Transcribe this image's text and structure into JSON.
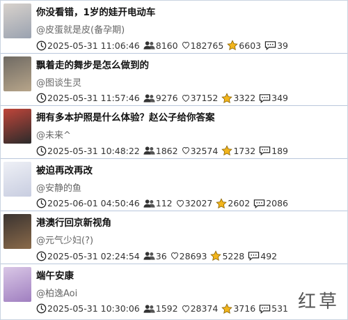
{
  "items": [
    {
      "title": "你没看错，1岁的娃开电动车",
      "author": "@皮蛋就是皮(备孕期)",
      "time": "2025-05-31 11:06:46",
      "viewers": "8160",
      "likes": "182765",
      "stars": "6603",
      "comments": "39",
      "thumb_colors": [
        "#d8d2cc",
        "#9aa2b0"
      ]
    },
    {
      "title": "飘着走的舞步是怎么做到的",
      "author": "@图谈生灵",
      "time": "2025-05-31 11:57:46",
      "viewers": "9276",
      "likes": "37152",
      "stars": "3322",
      "comments": "349",
      "thumb_colors": [
        "#6f6a63",
        "#b7a58a"
      ]
    },
    {
      "title": "拥有多本护照是什么体验？赵公子给你答案",
      "author": "@未来^",
      "time": "2025-05-31 10:48:22",
      "viewers": "1862",
      "likes": "32574",
      "stars": "1732",
      "comments": "189",
      "thumb_colors": [
        "#c0453a",
        "#2b2b2b"
      ]
    },
    {
      "title": "被迫再改再改",
      "author": "@安静的鱼",
      "time": "2025-06-01 04:50:46",
      "viewers": "112",
      "likes": "32027",
      "stars": "2602",
      "comments": "2086",
      "thumb_colors": [
        "#eef0f6",
        "#c8cde0"
      ]
    },
    {
      "title": "港澳行回京新视角",
      "author": "@元气少妇(?)",
      "time": "2025-05-31 02:24:54",
      "viewers": "36",
      "likes": "28693",
      "stars": "5228",
      "comments": "492",
      "thumb_colors": [
        "#3a3330",
        "#8a6a4a"
      ]
    },
    {
      "title": "端午安康",
      "author": "@柏逸Aoi",
      "time": "2025-05-31 10:30:06",
      "viewers": "1592",
      "likes": "28374",
      "stars": "3716",
      "comments": "531",
      "thumb_colors": [
        "#d9c7e6",
        "#a07fc0"
      ]
    }
  ],
  "watermark": "红草",
  "icons": {
    "time": "clock-icon",
    "viewers": "viewers-icon",
    "likes": "heart-icon",
    "stars": "star-icon",
    "comments": "comment-icon"
  },
  "colors": {
    "divider": "#b9c7dc",
    "star": "#f2b51c",
    "author": "#666666"
  }
}
